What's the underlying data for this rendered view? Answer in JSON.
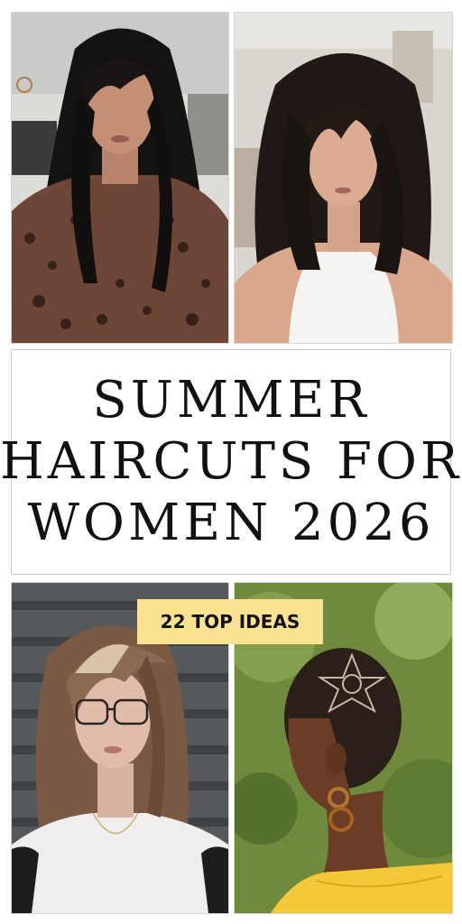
{
  "title": {
    "line1": "SUMMER",
    "line2": "HAIRCUTS FOR",
    "line3": "WOMEN 2026"
  },
  "badge": {
    "label": "22 TOP IDEAS"
  },
  "colors": {
    "badge_bg": "#fbe293",
    "title_text": "#111111",
    "frame_border": "#d6d6d6"
  }
}
